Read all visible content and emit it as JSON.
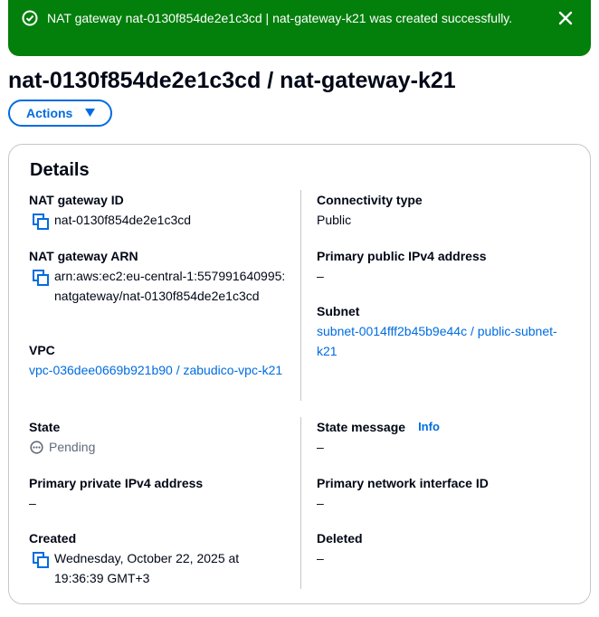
{
  "flash": {
    "message": "NAT gateway nat-0130f854de2e1c3cd | nat-gateway-k21 was created successfully.",
    "colors": {
      "background": "#037f0c",
      "text": "#ffffff"
    },
    "icons": {
      "status": "success-check-icon",
      "dismiss": "close-icon"
    }
  },
  "page_title": "nat-0130f854de2e1c3cd / nat-gateway-k21",
  "actions": {
    "label": "Actions",
    "icon": "caret-down-icon",
    "color": "#006ce0"
  },
  "details": {
    "title": "Details",
    "left": {
      "nat_gateway_id": {
        "label": "NAT gateway ID",
        "value": "nat-0130f854de2e1c3cd"
      },
      "nat_gateway_arn": {
        "label": "NAT gateway ARN",
        "value": "arn:aws:ec2:eu-central-1:557991640995:natgateway/nat-0130f854de2e1c3cd"
      },
      "vpc": {
        "label": "VPC",
        "value": "vpc-036dee0669b921b90 / zabudico-vpc-k21"
      },
      "state": {
        "label": "State",
        "value": "Pending"
      },
      "primary_private_ipv4": {
        "label": "Primary private IPv4 address",
        "value": "–"
      },
      "created": {
        "label": "Created",
        "value": "Wednesday, October 22, 2025 at 19:36:39 GMT+3"
      }
    },
    "right": {
      "connectivity_type": {
        "label": "Connectivity type",
        "value": "Public"
      },
      "primary_public_ipv4": {
        "label": "Primary public IPv4 address",
        "value": "–"
      },
      "subnet": {
        "label": "Subnet",
        "value": "subnet-0014fff2b45b9e44c / public-subnet-k21"
      },
      "state_message": {
        "label": "State message",
        "info": "Info",
        "value": "–"
      },
      "primary_network_interface": {
        "label": "Primary network interface ID",
        "value": "–"
      },
      "deleted": {
        "label": "Deleted",
        "value": "–"
      }
    }
  },
  "colors": {
    "link": "#006ce0",
    "divider": "#c6c6cd",
    "text": "#000716",
    "muted": "#5f6b7a"
  }
}
